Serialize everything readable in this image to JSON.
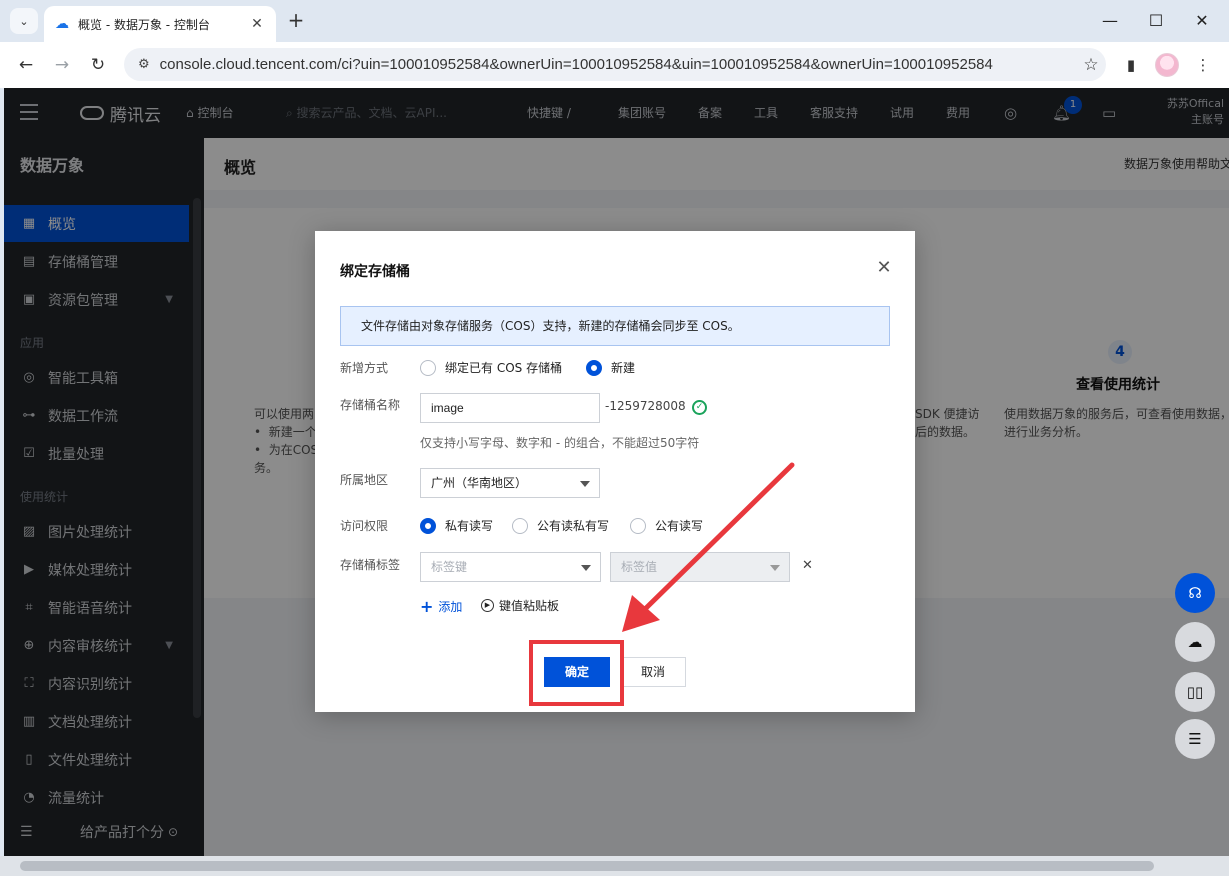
{
  "browser": {
    "tab_title": "概览 - 数据万象 - 控制台",
    "url": "console.cloud.tencent.com/ci?uin=100010952584&ownerUin=100010952584&uin=100010952584&ownerUin=100010952584"
  },
  "topnav": {
    "logo": "腾讯云",
    "console": "控制台",
    "search_placeholder": "搜索云产品、文档、云API...",
    "shortcut": "快捷键 /",
    "items": [
      "集团账号",
      "备案",
      "工具",
      "客服支持",
      "试用",
      "费用"
    ],
    "bell_count": "1",
    "user_line1": "苏苏Offical",
    "user_line2": "主账号"
  },
  "sidebar": {
    "title": "数据万象",
    "items": [
      {
        "label": "概览",
        "icon": "grid-icon"
      },
      {
        "label": "存储桶管理",
        "icon": "bucket-icon"
      },
      {
        "label": "资源包管理",
        "icon": "package-icon"
      }
    ],
    "group_apply": "应用",
    "apply_items": [
      {
        "label": "智能工具箱",
        "icon": "toolbox-icon"
      },
      {
        "label": "数据工作流",
        "icon": "workflow-icon"
      },
      {
        "label": "批量处理",
        "icon": "batch-icon"
      }
    ],
    "group_stats": "使用统计",
    "stats_items": [
      {
        "label": "图片处理统计",
        "icon": "image-stat-icon"
      },
      {
        "label": "媒体处理统计",
        "icon": "media-stat-icon"
      },
      {
        "label": "智能语音统计",
        "icon": "voice-stat-icon"
      },
      {
        "label": "内容审核统计",
        "icon": "audit-stat-icon"
      },
      {
        "label": "内容识别统计",
        "icon": "recognize-stat-icon"
      },
      {
        "label": "文档处理统计",
        "icon": "doc-stat-icon"
      },
      {
        "label": "文件处理统计",
        "icon": "file-stat-icon"
      },
      {
        "label": "流量统计",
        "icon": "traffic-stat-icon"
      }
    ],
    "feedback": "给产品打个分"
  },
  "content": {
    "title": "概览",
    "help": "数据万象使用帮助文",
    "left_text_1": "可以使用两",
    "left_text_2": "新建一个",
    "left_text_3": "为在COS",
    "left_text_4": "务。",
    "mid_text_1": "SDK 便捷访",
    "mid_text_2": "后的数据。",
    "step_number": "4",
    "step_title": "查看使用统计",
    "step_desc_1": "使用数据万象的服务后，可查看使用数据，",
    "step_desc_2": "进行业务分析。"
  },
  "dialog": {
    "title": "绑定存储桶",
    "notice": "文件存储由对象存储服务（COS）支持，新建的存储桶会同步至 COS。",
    "add_mode_label": "新增方式",
    "add_mode_options": [
      "绑定已有 COS 存储桶",
      "新建"
    ],
    "add_mode_selected": "新建",
    "bucket_name_label": "存储桶名称",
    "bucket_name_value": "image",
    "bucket_suffix": "-1259728008",
    "bucket_hint": "仅支持小写字母、数字和 - 的组合，不能超过50字符",
    "region_label": "所属地区",
    "region_value": "广州（华南地区）",
    "access_label": "访问权限",
    "access_options": [
      "私有读写",
      "公有读私有写",
      "公有读写"
    ],
    "access_selected": "私有读写",
    "tag_label": "存储桶标签",
    "tag_key_placeholder": "标签键",
    "tag_value_placeholder": "标签值",
    "add_link": "添加",
    "paste_link": "键值粘贴板",
    "confirm": "确定",
    "cancel": "取消"
  },
  "colors": {
    "primary": "#0052d9",
    "annotation": "#e8383d"
  }
}
